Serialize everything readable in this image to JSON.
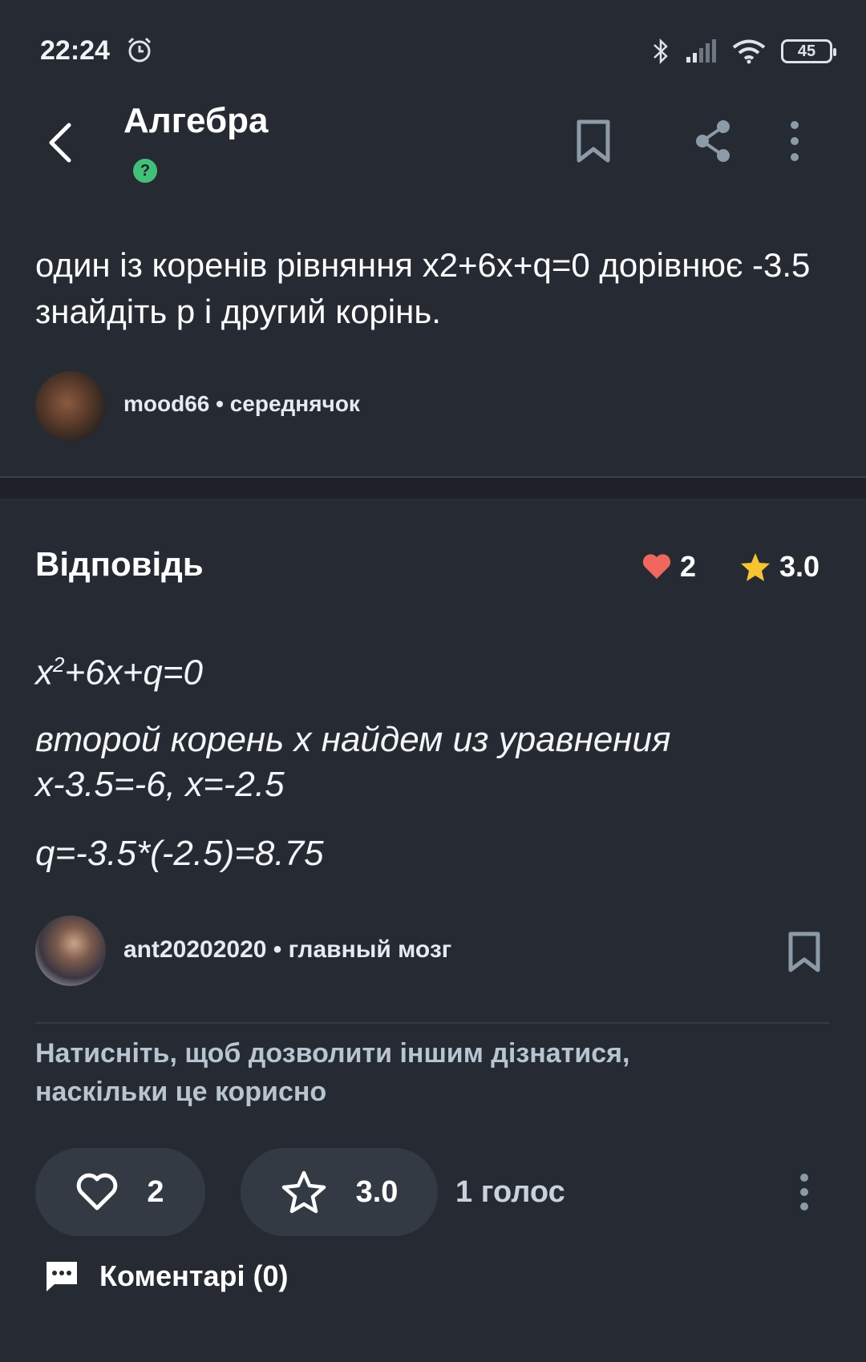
{
  "status_bar": {
    "time": "22:24",
    "battery": "45"
  },
  "header": {
    "title": "Алгебра",
    "subject_badge": "?"
  },
  "question": {
    "text": "один із коренів рівняння x2+6x+q=0 дорівнює -3.5 знайдіть p і другий корінь.",
    "author": "mood66 • середнячок"
  },
  "answer": {
    "heading": "Відповідь",
    "likes": "2",
    "rating": "3.0",
    "lines": {
      "eq_x": "x",
      "eq_sup": "2",
      "eq_rest": "+6x+q=0",
      "line2": "второй корень х найдем из уравнения",
      "line3": "х-3.5=-6, х=-2.5",
      "line4": "q=-3.5*(-2.5)=8.75"
    },
    "author": "ant20202020 • главный мозг",
    "rate_prompt": "Натисніть, щоб дозволити іншим дізнатися, наскільки це корисно",
    "thanks_count": "2",
    "rate_value": "3.0",
    "votes": "1 голос",
    "comments": "Коментарі (0)"
  },
  "colors": {
    "background": "#262b33",
    "heart": "#f0685d",
    "star": "#f6c431",
    "badge": "#42c07a",
    "icon_grey": "#8d9aa8"
  }
}
